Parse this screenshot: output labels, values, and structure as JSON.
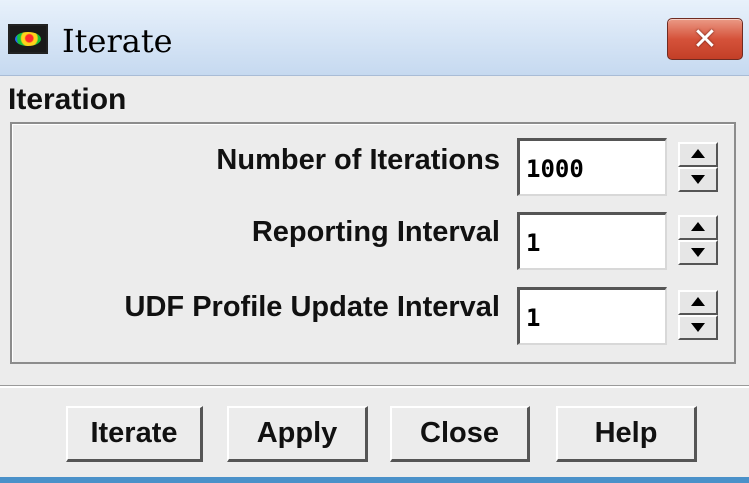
{
  "window": {
    "title": "Iterate",
    "icon": "fluent-app-icon",
    "close_glyph": "✕"
  },
  "group": {
    "label": "Iteration",
    "fields": [
      {
        "label": "Number of Iterations",
        "value": "1000"
      },
      {
        "label": "Reporting Interval",
        "value": "1"
      },
      {
        "label": "UDF Profile Update Interval",
        "value": "1"
      }
    ]
  },
  "buttons": {
    "iterate": "Iterate",
    "apply": "Apply",
    "close": "Close",
    "help": "Help"
  },
  "colors": {
    "close_button": "#d5523a",
    "title_bar": "#d5e4f5",
    "dialog_bg": "#ececec"
  }
}
